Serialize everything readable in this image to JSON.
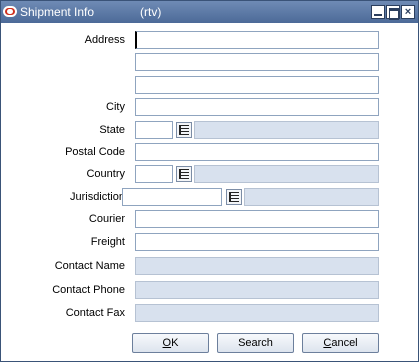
{
  "window": {
    "title": "Shipment Info",
    "subtitle": "(rtv)"
  },
  "form": {
    "address_label": "Address",
    "address_line1": "",
    "address_line2": "",
    "address_line3": "",
    "city_label": "City",
    "city": "",
    "state_label": "State",
    "state_code": "",
    "state_desc": "",
    "postal_code_label": "Postal Code",
    "postal_code": "",
    "country_label": "Country",
    "country_code": "",
    "country_desc": "",
    "jurisdiction_label": "Jurisdiction",
    "jurisdiction_code": "",
    "jurisdiction_desc": "",
    "courier_label": "Courier",
    "courier": "",
    "freight_label": "Freight",
    "freight": "",
    "contact_name_label": "Contact Name",
    "contact_name": "",
    "contact_phone_label": "Contact Phone",
    "contact_phone": "",
    "contact_fax_label": "Contact Fax",
    "contact_fax": ""
  },
  "buttons": {
    "ok_mnemonic": "O",
    "ok_rest": "K",
    "search_label": "Search",
    "cancel_mnemonic": "C",
    "cancel_rest": "ancel"
  },
  "colors": {
    "titlebar": "#5a77a6",
    "readonly_field": "#d8e1ee",
    "field_border": "#8fa4bf"
  }
}
